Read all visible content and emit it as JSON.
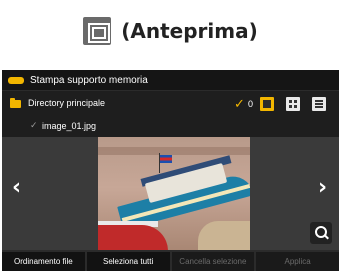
{
  "heading": {
    "icon": "preview-view-icon",
    "title": "(Anteprima)"
  },
  "screen": {
    "title": "Stampa supporto memoria",
    "directory": "Directory principale",
    "selected_count": "0",
    "file_name": "image_01.jpg",
    "view_modes": [
      "preview",
      "thumbnail",
      "list"
    ],
    "active_view_mode": "preview",
    "accent_color": "#f2b600",
    "nav": {
      "prev": "‹",
      "next": "›"
    },
    "buttons": {
      "sort": "Ordinamento file",
      "select_all": "Seleziona tutti",
      "clear_selection": "Cancella selezione",
      "apply": "Applica"
    }
  }
}
